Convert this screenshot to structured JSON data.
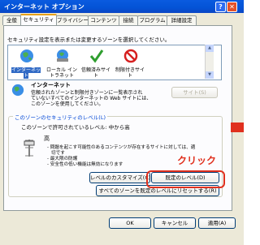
{
  "window": {
    "title": "インターネット オプション",
    "help_glyph": "?",
    "close_glyph": "✕"
  },
  "tabs": [
    {
      "label": "全般",
      "active": false
    },
    {
      "label": "セキュリティ",
      "active": true
    },
    {
      "label": "プライバシー",
      "active": false
    },
    {
      "label": "コンテンツ",
      "active": false
    },
    {
      "label": "接続",
      "active": false
    },
    {
      "label": "プログラム",
      "active": false
    },
    {
      "label": "詳細設定",
      "active": false
    }
  ],
  "security": {
    "instruction": "セキュリティ設定を表示または変更するゾーンを選択してください。",
    "zones": [
      {
        "label": "インターネット",
        "icon": "globe-icon",
        "selected": true
      },
      {
        "label": "ローカル イントラネット",
        "icon": "intranet-icon",
        "selected": false
      },
      {
        "label": "信頼済みサイト",
        "icon": "checkmark-icon",
        "selected": false
      },
      {
        "label": "制限付きサイト",
        "icon": "no-entry-icon",
        "selected": false
      }
    ],
    "zone_title": "インターネット",
    "zone_desc_1": "信頼されたゾーンと制限付きゾーンに一覧表示され",
    "zone_desc_2": "ていないすべてのインターネットの Web サイトには、",
    "zone_desc_3": "このゾーンを使用してください。",
    "sites_button": "サイト(S)"
  },
  "level_group": {
    "label": "このゾーンのセキュリティのレベル(L)",
    "allowed_levels": "このゾーンで許可されているレベル: 中から高",
    "level_name": "高",
    "bullet_1": "- 問題を起こす可能性のあるコンテンツが存在するサイトに対しては、適",
    "bullet_1b": "切です",
    "bullet_2": "- 最大限の防護",
    "bullet_3": "- 安全性の低い機能は無効になります",
    "custom_button": "レベルのカスタマイズ(C)...",
    "default_button": "既定のレベル(D)",
    "reset_all_button": "すべてのゾーンを既定のレベルにリセットする(R)"
  },
  "footer": {
    "ok": "OK",
    "cancel": "キャンセル",
    "apply": "適用(A)"
  },
  "annotation": {
    "text": "クリック",
    "color": "#e0301e"
  }
}
